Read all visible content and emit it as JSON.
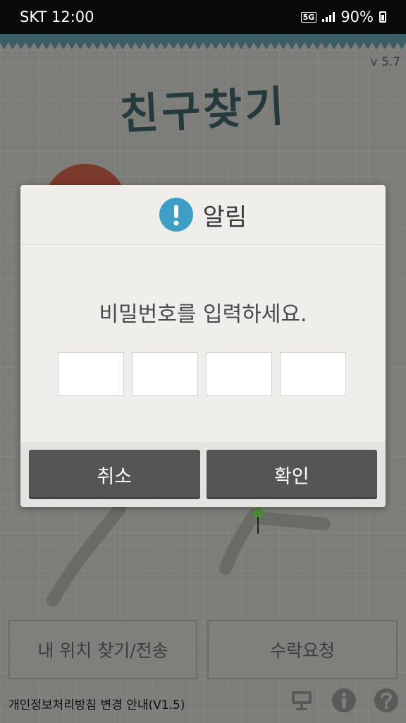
{
  "status_bar": {
    "carrier": "SKT",
    "time": "12:00",
    "network": "5G",
    "battery": "90%"
  },
  "app": {
    "version": "v 5.7",
    "title": "친구찾기",
    "buttons": {
      "find_location": "내 위치 찾기/전송",
      "accept_request": "수락요청"
    },
    "footer_notice": "개인정보처리방침 변경 안내(V1.5)"
  },
  "dialog": {
    "title": "알림",
    "message": "비밀번호를 입력하세요.",
    "pin_values": [
      "",
      "",
      "",
      ""
    ],
    "cancel_label": "취소",
    "confirm_label": "확인",
    "accent_color": "#3f9ec5"
  },
  "icons": [
    "alert-icon",
    "signal-icon",
    "battery-icon",
    "sign-icon",
    "info-icon",
    "help-icon"
  ]
}
